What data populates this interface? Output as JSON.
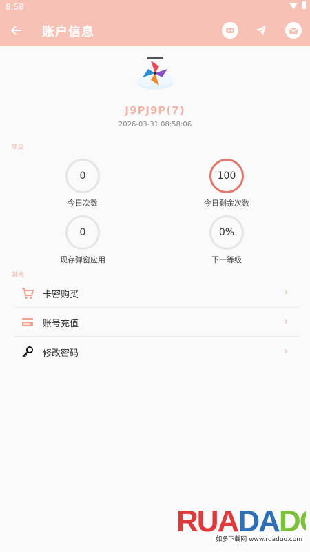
{
  "status_bar": {
    "time": "8:58",
    "wifi_icon": "wifi-icon",
    "battery_icon": "battery-icon"
  },
  "app_bar": {
    "title": "账户信息",
    "back_icon": "arrow-left-icon",
    "actions": [
      "game-controller-icon",
      "telegram-icon",
      "mail-icon"
    ]
  },
  "profile": {
    "username": "J9PJ9P(7)",
    "datetime": "2026-03-31 08:58:06"
  },
  "sections": {
    "items_label": "项目",
    "other_label": "其他"
  },
  "stats": [
    {
      "value": "0",
      "label": "今日次数"
    },
    {
      "value": "100",
      "label": "今日剩余次数"
    },
    {
      "value": "0",
      "label": "现存弹窗应用"
    },
    {
      "value": "0%",
      "label": "下一等级"
    }
  ],
  "menu": [
    {
      "label": "卡密购买",
      "icon": "cart-icon"
    },
    {
      "label": "账号充值",
      "icon": "credit-card-icon"
    },
    {
      "label": "修改密码",
      "icon": "key-icon"
    }
  ],
  "watermark": {
    "brand": "RUADADO",
    "sub": "如多下载网 www.ruaduo.com"
  },
  "colors": {
    "accent": "#f7c2b5",
    "accent_text": "#f3b4a8",
    "ring_red": "#e07a70"
  }
}
